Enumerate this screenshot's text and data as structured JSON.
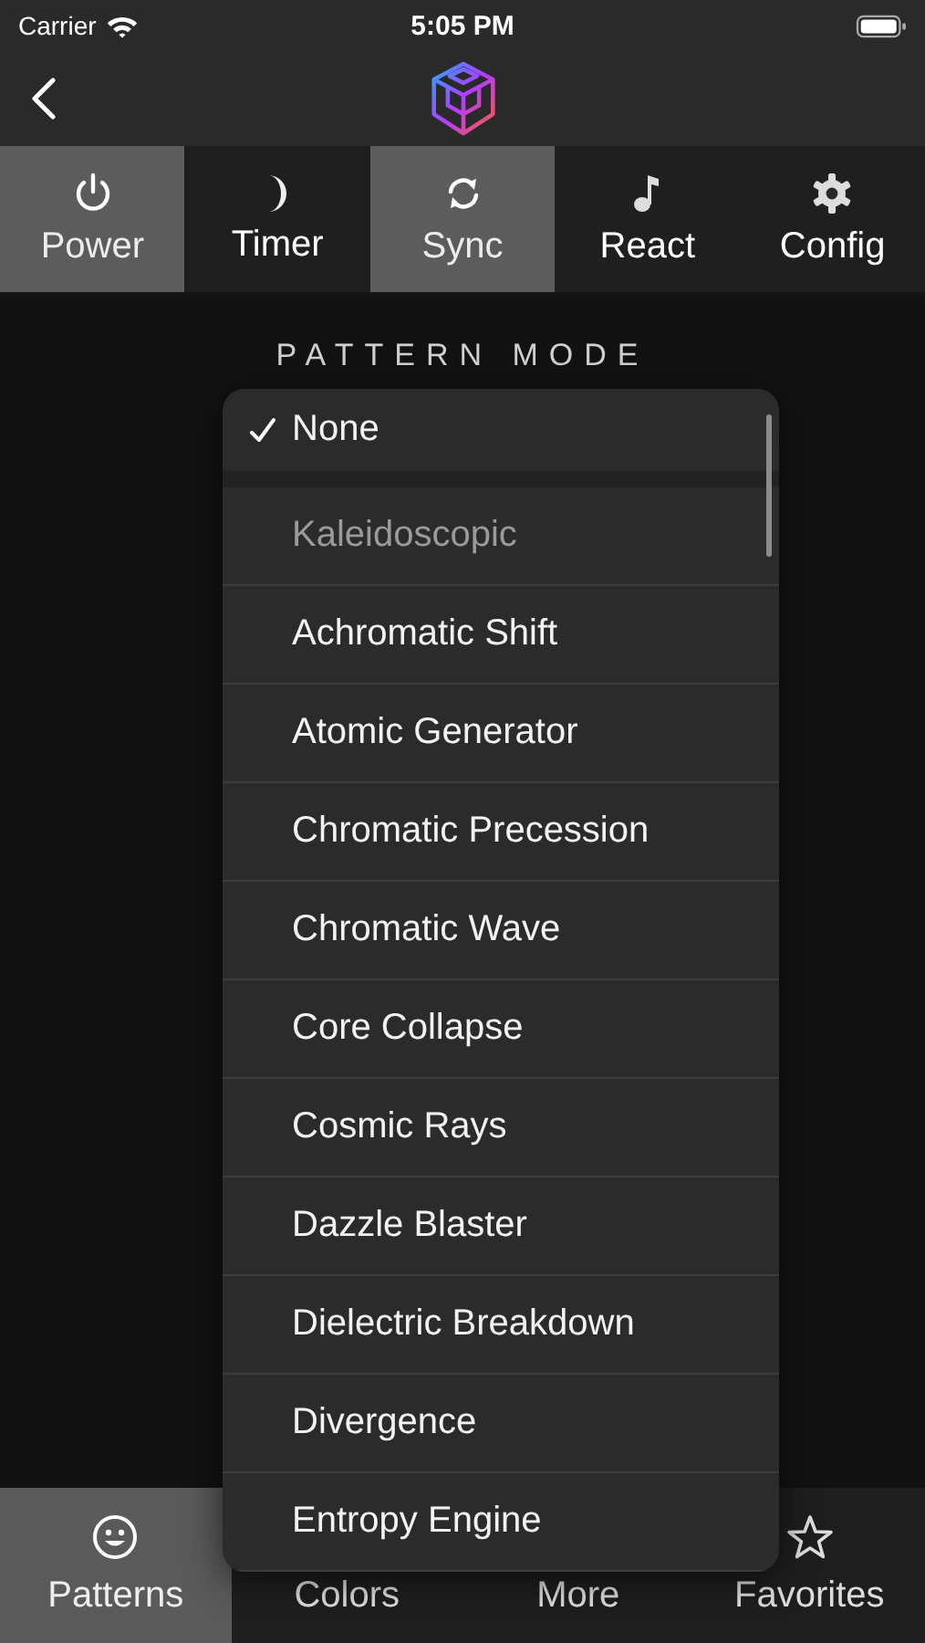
{
  "status_bar": {
    "carrier": "Carrier",
    "time": "5:05 PM"
  },
  "top_tabs": [
    {
      "label": "Power",
      "selected": true
    },
    {
      "label": "Timer",
      "selected": false
    },
    {
      "label": "Sync",
      "selected": true
    },
    {
      "label": "React",
      "selected": false
    },
    {
      "label": "Config",
      "selected": false
    }
  ],
  "heading": "PATTERN MODE",
  "menu": {
    "items": [
      {
        "kind": "option",
        "label": "None",
        "selected": true
      },
      {
        "kind": "header",
        "label": "Kaleidoscopic"
      },
      {
        "kind": "option",
        "label": "Achromatic Shift",
        "selected": false
      },
      {
        "kind": "option",
        "label": "Atomic Generator",
        "selected": false
      },
      {
        "kind": "option",
        "label": "Chromatic Precession",
        "selected": false
      },
      {
        "kind": "option",
        "label": "Chromatic Wave",
        "selected": false
      },
      {
        "kind": "option",
        "label": "Core Collapse",
        "selected": false
      },
      {
        "kind": "option",
        "label": "Cosmic Rays",
        "selected": false
      },
      {
        "kind": "option",
        "label": "Dazzle Blaster",
        "selected": false
      },
      {
        "kind": "option",
        "label": "Dielectric Breakdown",
        "selected": false
      },
      {
        "kind": "option",
        "label": "Divergence",
        "selected": false
      },
      {
        "kind": "option",
        "label": "Entropy Engine",
        "selected": false
      }
    ]
  },
  "bottom_tabs": [
    {
      "label": "Patterns",
      "selected": true
    },
    {
      "label": "Colors",
      "selected": false
    },
    {
      "label": "More",
      "selected": false
    },
    {
      "label": "Favorites",
      "selected": false
    }
  ]
}
